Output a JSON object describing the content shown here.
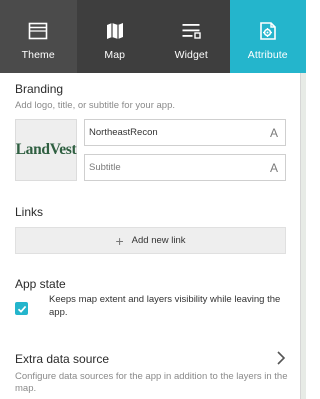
{
  "tabs": [
    {
      "label": "Theme",
      "icon": "theme-icon"
    },
    {
      "label": "Map",
      "icon": "map-icon"
    },
    {
      "label": "Widget",
      "icon": "widget-icon"
    },
    {
      "label": "Attribute",
      "icon": "attribute-icon",
      "active": true
    }
  ],
  "colors": {
    "tab_bar": "#3e3e3e",
    "active_tab": "#24b5cc",
    "logo_green": "#2f5f41"
  },
  "branding": {
    "heading": "Branding",
    "description": "Add logo, title, or subtitle for your app.",
    "logo_text": "LandVest",
    "title_value": "NortheastRecon",
    "subtitle_placeholder": "Subtitle",
    "font_button_glyph": "A"
  },
  "links": {
    "heading": "Links",
    "add_label": "Add new link"
  },
  "app_state": {
    "heading": "App state",
    "checked": true,
    "description": "Keeps map extent and layers visibility while leaving the app."
  },
  "extra_data": {
    "heading": "Extra data source",
    "description": "Configure data sources for the app in addition to the layers in the map."
  }
}
